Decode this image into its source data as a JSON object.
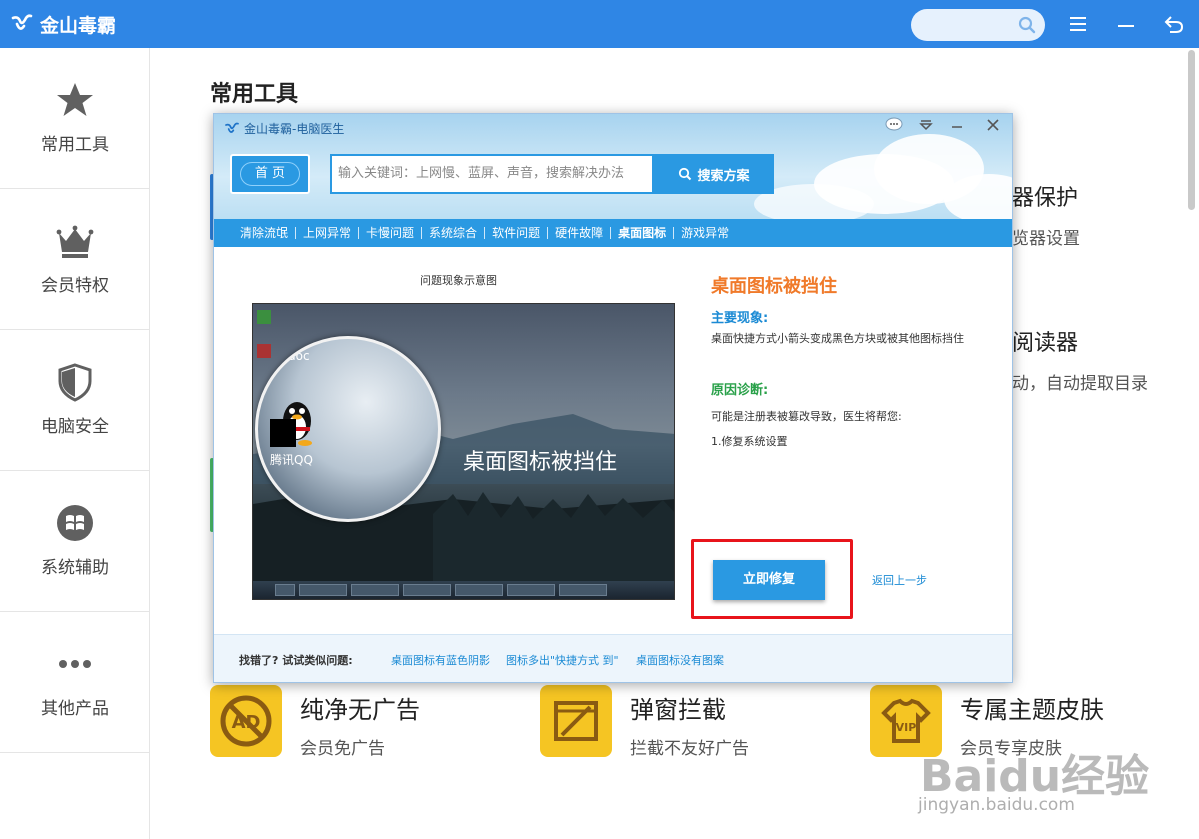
{
  "app": {
    "name": "金山毒霸",
    "colors": {
      "brand": "#2f86e5",
      "accent_yellow": "#f5c523",
      "highlight_red": "#e8141b"
    }
  },
  "sidebar": {
    "items": [
      {
        "label": "常用工具",
        "icon": "star-icon"
      },
      {
        "label": "会员特权",
        "icon": "crown-icon"
      },
      {
        "label": "电脑安全",
        "icon": "shield-icon"
      },
      {
        "label": "系统辅助",
        "icon": "windows-icon"
      },
      {
        "label": "其他产品",
        "icon": "more-icon"
      }
    ]
  },
  "main": {
    "title": "常用工具",
    "bg_tools": [
      {
        "title_fragment": "器保护",
        "desc_fragment": "览器设置"
      },
      {
        "title_fragment": "阅读器",
        "desc_fragment": "动，自动提取目录"
      }
    ],
    "tools": [
      {
        "title": "纯净无广告",
        "desc": "会员免广告",
        "icon": "no-ad-icon"
      },
      {
        "title": "弹窗拦截",
        "desc": "拦截不友好广告",
        "icon": "popup-block-icon"
      },
      {
        "title": "专属主题皮肤",
        "desc": "会员专享皮肤",
        "icon": "vip-shirt-icon"
      }
    ]
  },
  "dialog": {
    "title": "金山毒霸-电脑医生",
    "home_label": "首 页",
    "search_placeholder": "输入关键词：上网慢、蓝屏、声音，搜索解决办法",
    "search_button": "搜索方案",
    "categories": [
      "清除流氓",
      "上网异常",
      "卡慢问题",
      "系统综合",
      "软件问题",
      "硬件故障",
      "桌面图标",
      "游戏异常"
    ],
    "active_category": "桌面图标",
    "image_caption": "问题现象示意图",
    "screenshot": {
      "doc_label": "doc",
      "qq_label": "腾讯QQ",
      "caption": "桌面图标被挡住"
    },
    "issue_title": "桌面图标被挡住",
    "symptom_heading": "主要现象:",
    "symptom_text": "桌面快捷方式小箭头变成黑色方块或被其他图标挡住",
    "diagnosis_heading": "原因诊断:",
    "diagnosis_text": "可能是注册表被篡改导致，医生将帮您:",
    "diagnosis_step": "1.修复系统设置",
    "fix_button": "立即修复",
    "back_link": "返回上一步",
    "footer_label": "找错了? 试试类似问题:",
    "footer_links": [
      "桌面图标有蓝色阴影",
      "图标多出\"快捷方式 到\"",
      "桌面图标没有图案"
    ]
  },
  "watermark": {
    "text": "Baidu经验",
    "url": "jingyan.baidu.com"
  }
}
